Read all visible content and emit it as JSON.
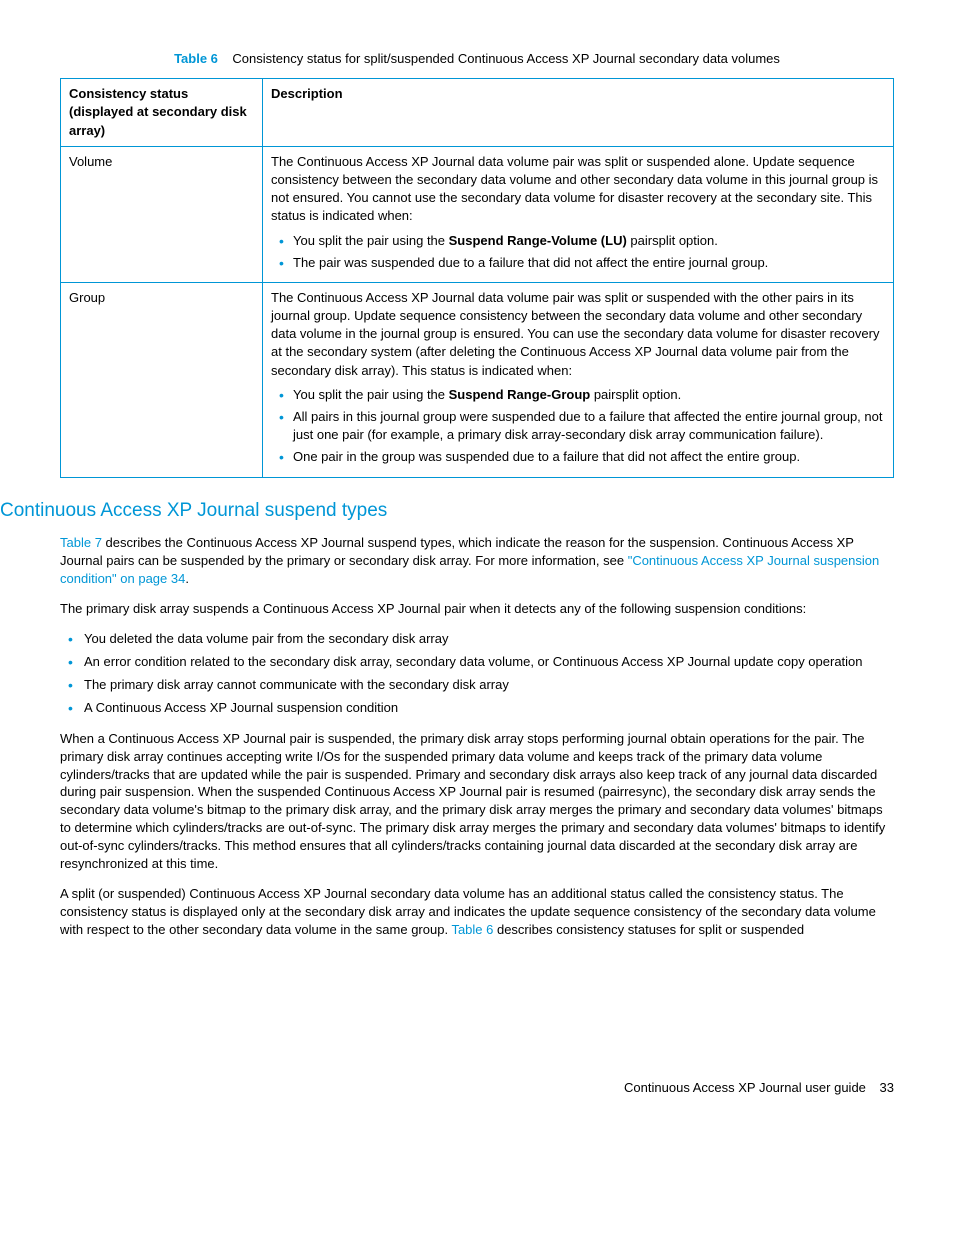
{
  "table": {
    "label": "Table 6",
    "caption": "Consistency status for split/suspended Continuous Access XP Journal secondary data volumes",
    "headers": {
      "col1": "Consistency status (displayed at secondary disk array)",
      "col2": "Description"
    },
    "rows": [
      {
        "status": "Volume",
        "desc_intro": "The Continuous Access XP Journal data volume pair was split or suspended alone. Update sequence consistency between the secondary data volume and other secondary data volume in this journal group is not ensured. You cannot use the secondary data volume for disaster recovery at the secondary site. This status is indicated when:",
        "bullets": [
          {
            "pre": "You split the pair using the ",
            "bold": "Suspend Range-Volume (LU)",
            "post": " pairsplit option."
          },
          {
            "pre": "The pair was suspended due to a failure that did not affect the entire journal group.",
            "bold": "",
            "post": ""
          }
        ]
      },
      {
        "status": "Group",
        "desc_intro": "The Continuous Access XP Journal data volume pair was split or suspended with the other pairs in its journal group. Update sequence consistency between the secondary data volume and other secondary data volume in the journal group is ensured. You can use the secondary data volume for disaster recovery at the secondary system (after deleting the Continuous Access XP Journal data volume pair from the secondary disk array). This status is indicated when:",
        "bullets": [
          {
            "pre": "You split the pair using the ",
            "bold": "Suspend Range-Group",
            "post": " pairsplit option."
          },
          {
            "pre": "All pairs in this journal group were suspended due to a failure that affected the entire journal group, not just one pair (for example, a primary disk array-secondary disk array communication failure).",
            "bold": "",
            "post": ""
          },
          {
            "pre": "One pair in the group was suspended due to a failure that did not affect the entire group.",
            "bold": "",
            "post": ""
          }
        ]
      }
    ]
  },
  "section": {
    "title": "Continuous Access XP Journal suspend types",
    "p1_a": "Table 7",
    "p1_b": " describes the Continuous Access XP Journal suspend types, which indicate the reason for the suspension. Continuous Access XP Journal pairs can be suspended by the primary or secondary disk array. For more information, see ",
    "p1_c": "\"Continuous Access XP Journal suspension condition\" on page 34",
    "p1_d": ".",
    "p2": "The primary disk array suspends a Continuous Access XP Journal pair when it detects any of the following suspension conditions:",
    "list1": [
      "You deleted the data volume pair from the secondary disk array",
      "An error condition related to the secondary disk array, secondary data volume, or Continuous Access XP Journal update copy operation",
      "The primary disk array cannot communicate with the secondary disk array",
      "A Continuous Access XP Journal suspension condition"
    ],
    "p3": "When a Continuous Access XP Journal pair is suspended, the primary disk array stops performing journal obtain operations for the pair. The primary disk array continues accepting write I/Os for the suspended primary data volume and keeps track of the primary data volume cylinders/tracks that are updated while the pair is suspended. Primary and secondary disk arrays also keep track of any journal data discarded during pair suspension. When the suspended Continuous Access XP Journal pair is resumed (pairresync), the secondary disk array sends the secondary data volume's bitmap to the primary disk array, and the primary disk array merges the primary and secondary data volumes' bitmaps to determine which cylinders/tracks are out-of-sync. The primary disk array merges the primary and secondary data volumes' bitmaps to identify out-of-sync cylinders/tracks. This method ensures that all cylinders/tracks containing journal data discarded at the secondary disk array are resynchronized at this time.",
    "p4_a": "A split (or suspended) Continuous Access XP Journal secondary data volume has an additional status called the consistency status. The consistency status is displayed only at the secondary disk array and indicates the update sequence consistency of the secondary data volume with respect to the other secondary data volume in the same group. ",
    "p4_b": "Table 6",
    "p4_c": " describes consistency statuses for split or suspended"
  },
  "footer": {
    "title": "Continuous Access XP Journal user guide",
    "page": "33"
  }
}
